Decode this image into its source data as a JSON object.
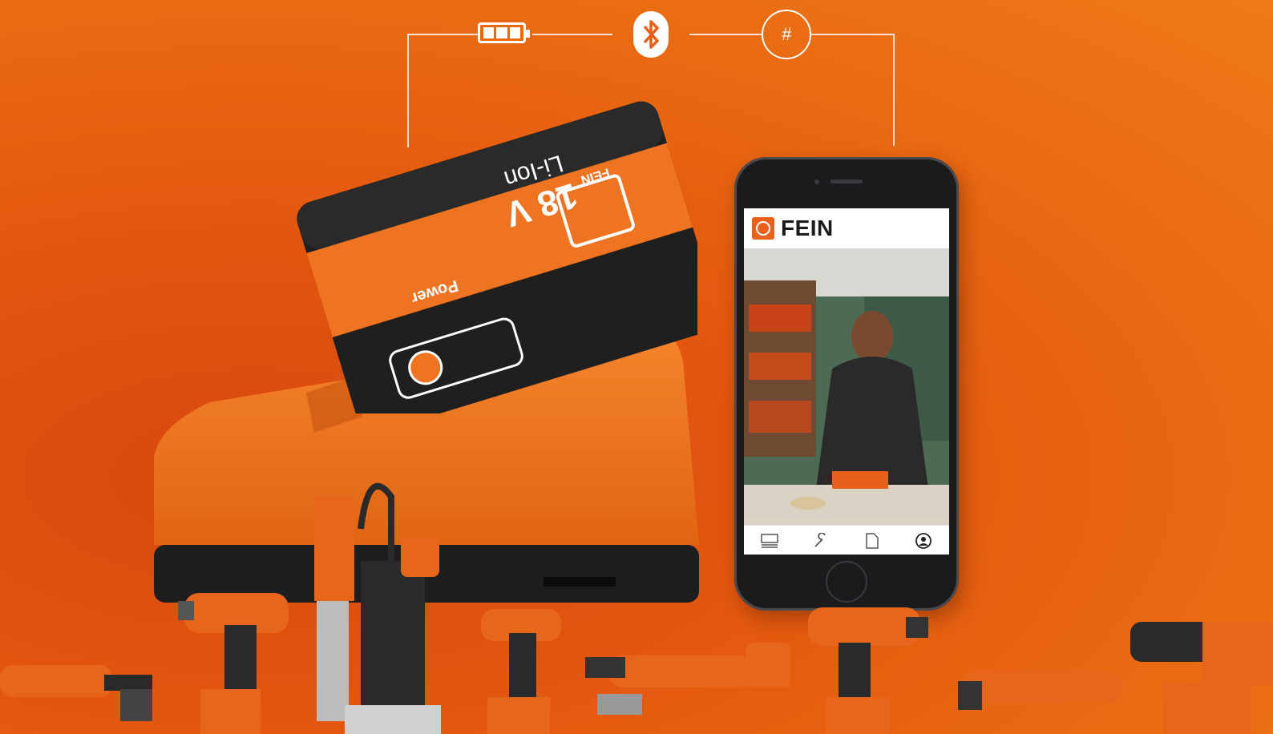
{
  "battery": {
    "voltage_label": "18 V",
    "chemistry_label": "Li-Ion",
    "brand_mark": "FEIN",
    "power_label": "Power"
  },
  "app": {
    "title": "FEIN",
    "nav": [
      {
        "icon": "list-icon"
      },
      {
        "icon": "wrench-icon"
      },
      {
        "icon": "document-icon"
      },
      {
        "icon": "profile-icon"
      }
    ]
  },
  "top_icons": [
    "battery-icon",
    "bluetooth-icon",
    "sync-number-icon"
  ],
  "sync_symbol": "#",
  "colors": {
    "brand_orange": "#e8601a",
    "background_orange": "#e2560f",
    "charger_black": "#1e1e1e"
  }
}
